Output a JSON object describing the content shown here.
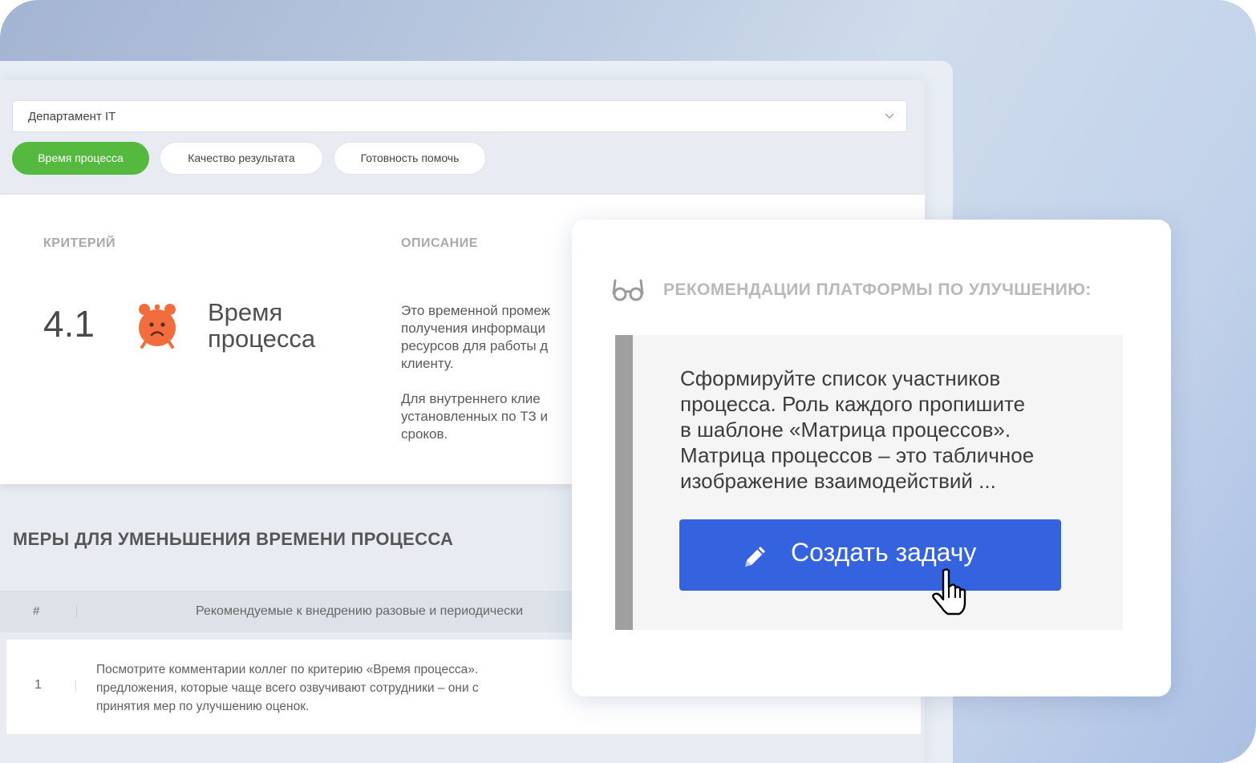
{
  "department_select": {
    "value": "Департамент IT"
  },
  "tabs": [
    {
      "label": "Время процесса",
      "active": true
    },
    {
      "label": "Качество результата",
      "active": false
    },
    {
      "label": "Готовность помочь",
      "active": false
    }
  ],
  "criteria_card": {
    "col_criterion": "КРИТЕРИЙ",
    "col_description": "ОПИСАНИЕ",
    "score": "4.1",
    "icon": "sad-alarm-clock-icon",
    "name_line1": "Время",
    "name_line2": "процесса",
    "description_lines": [
      "Это временной промеж",
      "получения информаци",
      "ресурсов для работы д",
      "клиенту."
    ],
    "description_lines_2": [
      "Для внутреннего клие",
      "установленных по ТЗ и",
      "сроков."
    ]
  },
  "measures": {
    "title": "МЕРЫ ДЛЯ УМЕНЬШЕНИЯ ВРЕМЕНИ ПРОЦЕССА",
    "header_num": "#",
    "header_text": "Рекомендуемые к внедрению разовые и периодически",
    "rows": [
      {
        "num": "1",
        "lines": [
          "Посмотрите комментарии коллег по критерию «Время процесса».",
          "предложения, которые чаще всего озвучивают сотрудники – они с",
          "принятия мер по улучшению оценок."
        ]
      }
    ]
  },
  "recommendation": {
    "icon": "glasses-icon",
    "title": "РЕКОМЕНДАЦИИ ПЛАТФОРМЫ ПО УЛУЧШЕНИЮ:",
    "text_lines": [
      "Сформируйте список участников",
      "процесса. Роль каждого пропишите",
      "в шаблоне «Матрица процессов».",
      "Матрица процессов – это табличное",
      "изображение взаимодействий ..."
    ],
    "button_label": "Создать задачу",
    "button_icon": "pencil-icon"
  },
  "colors": {
    "tab_active": "#55b83f",
    "button": "#3563e0",
    "emoji": "#f26d3d"
  }
}
